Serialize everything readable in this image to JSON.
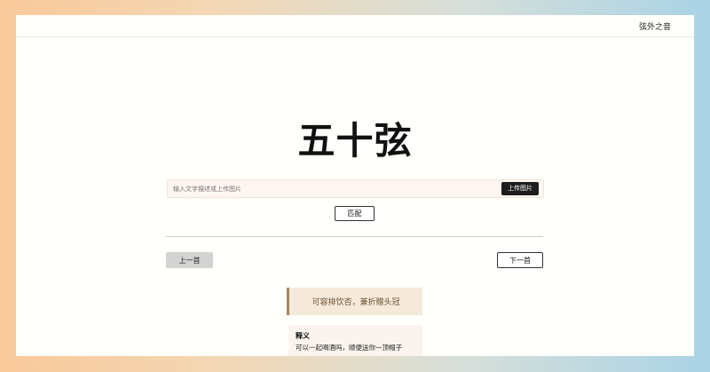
{
  "header": {
    "site_name": "弦外之音"
  },
  "main": {
    "title": "五十弦",
    "search": {
      "placeholder": "输入文字描述或上传图片",
      "upload_label": "上传图片"
    },
    "match_label": "匹配",
    "nav": {
      "prev_label": "上一首",
      "next_label": "下一首"
    },
    "verse": {
      "line": "可容排饮否，兼折赠头冠"
    },
    "meaning": {
      "label": "释义",
      "text": "可以一起喝酒吗，顺便送你一顶帽子"
    }
  },
  "colors": {
    "accent_dark": "#1e1e1e",
    "verse_border": "#a8865c",
    "verse_bg": "#f5e9da"
  }
}
